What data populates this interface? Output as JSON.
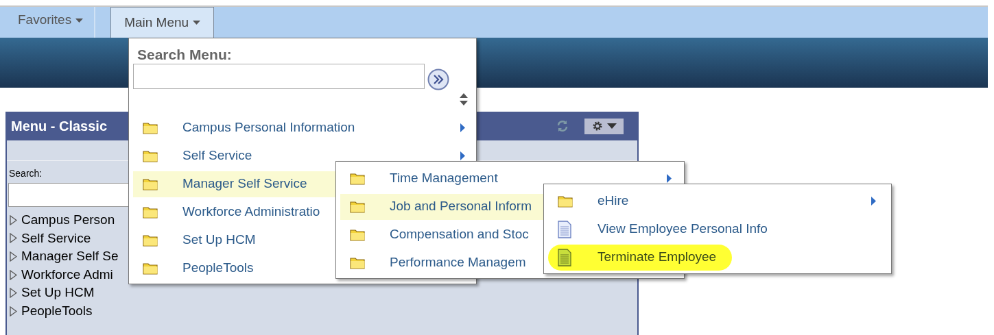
{
  "nav": {
    "tabs": [
      {
        "label": "Favorites",
        "selected": false
      },
      {
        "label": "Main Menu",
        "selected": true
      }
    ]
  },
  "pagelet": {
    "title": "Menu - Classic",
    "search_label": "Search:",
    "tree": [
      {
        "label": "Campus Person"
      },
      {
        "label": "Self Service"
      },
      {
        "label": "Manager Self Se"
      },
      {
        "label": "Workforce Admi"
      },
      {
        "label": "Set Up HCM"
      },
      {
        "label": "PeopleTools"
      }
    ]
  },
  "main_menu": {
    "search_title": "Search Menu:",
    "items": [
      {
        "label": "Campus Personal Information",
        "kind": "folder",
        "has_submenu": true,
        "selected": false
      },
      {
        "label": "Self Service",
        "kind": "folder",
        "has_submenu": true,
        "selected": false
      },
      {
        "label": "Manager Self Service",
        "kind": "folder",
        "selected": true
      },
      {
        "label": "Workforce Administratio",
        "kind": "folder",
        "selected": false
      },
      {
        "label": "Set Up HCM",
        "kind": "folder",
        "selected": false
      },
      {
        "label": "PeopleTools",
        "kind": "folder",
        "selected": false
      }
    ]
  },
  "submenu": {
    "items": [
      {
        "label": "Time Management",
        "kind": "folder",
        "has_submenu": true,
        "selected": false
      },
      {
        "label": "Job and Personal Inform",
        "kind": "folder",
        "selected": true
      },
      {
        "label": "Compensation and Stoc",
        "kind": "folder",
        "selected": false
      },
      {
        "label": "Performance Managem",
        "kind": "folder",
        "selected": false
      }
    ]
  },
  "submenu_2": {
    "items": [
      {
        "label": "eHire",
        "kind": "folder",
        "has_submenu": true,
        "highlighted": false
      },
      {
        "label": "View Employee Personal Info",
        "kind": "page",
        "has_submenu": false,
        "highlighted": false
      },
      {
        "label": "Terminate Employee",
        "kind": "page",
        "has_submenu": false,
        "highlighted": true
      }
    ]
  }
}
